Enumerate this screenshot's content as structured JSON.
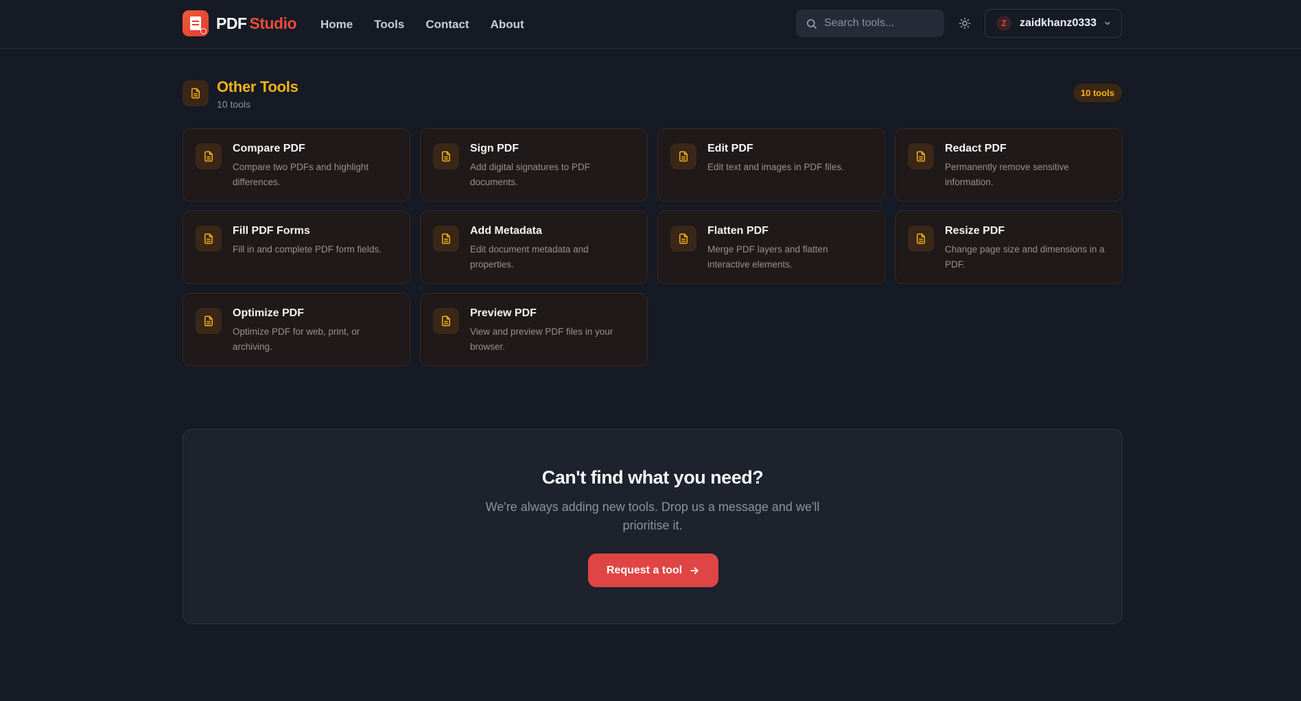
{
  "header": {
    "brand_part1": "PDF",
    "brand_part2": "Studio",
    "nav": [
      "Home",
      "Tools",
      "Contact",
      "About"
    ],
    "search_placeholder": "Search tools...",
    "user_initial": "Z",
    "username": "zaidkhanz0333"
  },
  "section": {
    "title": "Other Tools",
    "subtitle": "10 tools",
    "badge": "10 tools"
  },
  "tools": [
    {
      "title": "Compare PDF",
      "desc": "Compare two PDFs and highlight differences."
    },
    {
      "title": "Sign PDF",
      "desc": "Add digital signatures to PDF documents."
    },
    {
      "title": "Edit PDF",
      "desc": "Edit text and images in PDF files."
    },
    {
      "title": "Redact PDF",
      "desc": "Permanently remove sensitive information."
    },
    {
      "title": "Fill PDF Forms",
      "desc": "Fill in and complete PDF form fields."
    },
    {
      "title": "Add Metadata",
      "desc": "Edit document metadata and properties."
    },
    {
      "title": "Flatten PDF",
      "desc": "Merge PDF layers and flatten interactive elements."
    },
    {
      "title": "Resize PDF",
      "desc": "Change page size and dimensions in a PDF."
    },
    {
      "title": "Optimize PDF",
      "desc": "Optimize PDF for web, print, or archiving."
    },
    {
      "title": "Preview PDF",
      "desc": "View and preview PDF files in your browser."
    }
  ],
  "cta": {
    "heading": "Can't find what you need?",
    "text": "We're always adding new tools. Drop us a message and we'll prioritise it.",
    "button": "Request a tool"
  },
  "colors": {
    "accent_red": "#e04545",
    "accent_amber": "#f5b31a",
    "background": "#151a24"
  }
}
